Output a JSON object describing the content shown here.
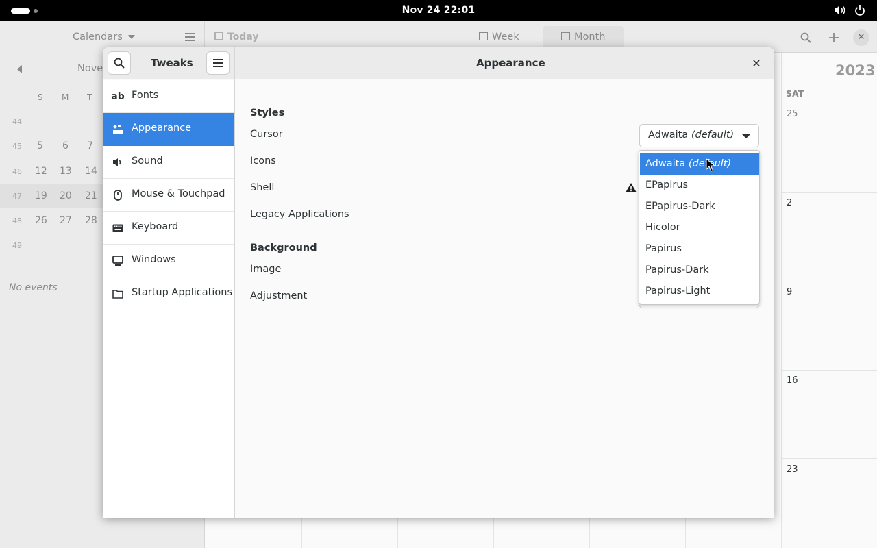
{
  "topbar": {
    "clock": "Nov 24  22:01"
  },
  "calendar": {
    "sidebar_title": "Calendars",
    "month_partial": "Nove",
    "weekdays": [
      "S",
      "M",
      "T"
    ],
    "weeks": [
      {
        "num": "44",
        "days": [
          "",
          "",
          ""
        ]
      },
      {
        "num": "45",
        "days": [
          "5",
          "6",
          "7"
        ]
      },
      {
        "num": "46",
        "days": [
          "12",
          "13",
          "14"
        ]
      },
      {
        "num": "47",
        "days": [
          "19",
          "20",
          "21"
        ]
      },
      {
        "num": "48",
        "days": [
          "26",
          "27",
          "28"
        ]
      },
      {
        "num": "49",
        "days": [
          "",
          "",
          ""
        ]
      }
    ],
    "no_events": "No events",
    "today_label": "Today",
    "week_label": "Week",
    "month_label": "Month",
    "year": "2023",
    "sat_label": "SAT",
    "sat_dates": [
      "25",
      "2",
      "9",
      "16",
      "23"
    ]
  },
  "tweaks": {
    "sidebar_title": "Tweaks",
    "page_title": "Appearance",
    "sidebar_items": [
      {
        "label": "Fonts",
        "icon": "fonts-icon"
      },
      {
        "label": "Appearance",
        "icon": "appearance-icon"
      },
      {
        "label": "Sound",
        "icon": "speaker-icon"
      },
      {
        "label": "Mouse & Touchpad",
        "icon": "mouse-icon"
      },
      {
        "label": "Keyboard",
        "icon": "keyboard-icon"
      },
      {
        "label": "Windows",
        "icon": "monitor-icon"
      },
      {
        "label": "Startup Applications",
        "icon": "folder-icon"
      }
    ],
    "active_item": "Appearance",
    "styles_heading": "Styles",
    "styles_rows": [
      "Cursor",
      "Icons",
      "Shell",
      "Legacy Applications"
    ],
    "background_heading": "Background",
    "background_rows": [
      "Image",
      "Adjustment"
    ],
    "cursor_combo": {
      "value": "Adwaita",
      "suffix": "(default)"
    },
    "popover_options": [
      {
        "label": "Adwaita",
        "suffix": "(default)"
      },
      {
        "label": "EPapirus",
        "suffix": ""
      },
      {
        "label": "EPapirus-Dark",
        "suffix": ""
      },
      {
        "label": "Hicolor",
        "suffix": ""
      },
      {
        "label": "Papirus",
        "suffix": ""
      },
      {
        "label": "Papirus-Dark",
        "suffix": ""
      },
      {
        "label": "Papirus-Light",
        "suffix": ""
      }
    ],
    "accent_color": "#3584e4"
  }
}
